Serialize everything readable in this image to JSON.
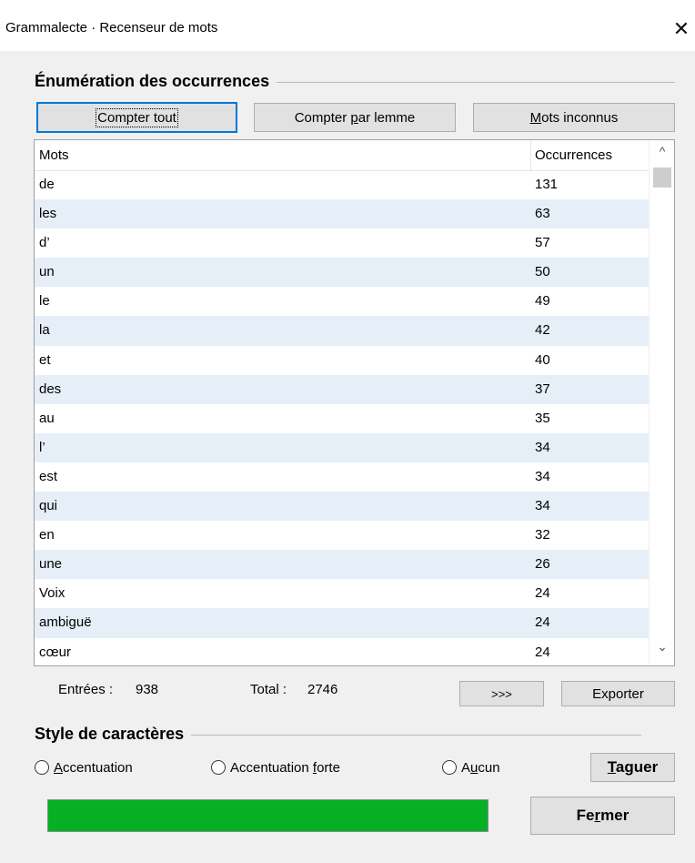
{
  "window": {
    "title": "Grammalecte · Recenseur de mots",
    "close_glyph": "✕"
  },
  "enumeration": {
    "section_title": "Énumération des occurrences",
    "buttons": {
      "count_all": "Compter tout",
      "count_by_lemma_pre": "Compter ",
      "count_by_lemma_key": "p",
      "count_by_lemma_post": "ar lemme",
      "unknown_words_key": "M",
      "unknown_words_post": "ots inconnus"
    }
  },
  "table": {
    "columns": [
      "Mots",
      "Occurrences"
    ],
    "rows": [
      {
        "word": "de",
        "count": "131"
      },
      {
        "word": "les",
        "count": "63"
      },
      {
        "word": "d’",
        "count": "57"
      },
      {
        "word": "un",
        "count": "50"
      },
      {
        "word": "le",
        "count": "49"
      },
      {
        "word": "la",
        "count": "42"
      },
      {
        "word": "et",
        "count": "40"
      },
      {
        "word": "des",
        "count": "37"
      },
      {
        "word": "au",
        "count": "35"
      },
      {
        "word": "l’",
        "count": "34"
      },
      {
        "word": "est",
        "count": "34"
      },
      {
        "word": "qui",
        "count": "34"
      },
      {
        "word": "en",
        "count": "32"
      },
      {
        "word": "une",
        "count": "26"
      },
      {
        "word": "Voix",
        "count": "24"
      },
      {
        "word": "ambiguë",
        "count": "24"
      },
      {
        "word": "cœur",
        "count": "24"
      }
    ],
    "scroll_up_glyph": "^",
    "scroll_down_glyph": "⌄"
  },
  "stats": {
    "entries_label": "Entrées :",
    "entries_value": "938",
    "total_label": "Total :",
    "total_value": "2746",
    "more_button": ">>>",
    "export_button": "Exporter"
  },
  "style": {
    "section_title": "Style de caractères",
    "options": [
      {
        "key": "A",
        "rest": "ccentuation",
        "selected": false
      },
      {
        "pre": "Accentuation ",
        "key": "f",
        "rest": "orte",
        "selected": false
      },
      {
        "pre": "A",
        "key": "u",
        "rest": "cun",
        "selected": false
      }
    ],
    "tag_key": "T",
    "tag_rest": "aguer"
  },
  "footer": {
    "progress": 1.0,
    "progress_color": "#06b025",
    "close_pre": "Fe",
    "close_key": "r",
    "close_post": "mer"
  }
}
